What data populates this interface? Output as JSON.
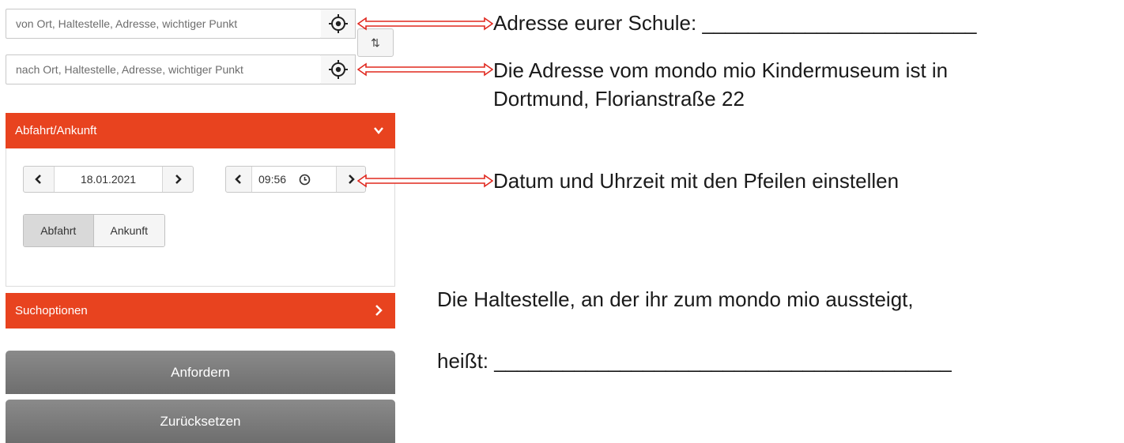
{
  "form": {
    "from_placeholder": "von Ort, Haltestelle, Adresse, wichtiger Punkt",
    "to_placeholder": "nach Ort, Haltestelle, Adresse, wichtiger Punkt",
    "swap_glyph": "⇅",
    "gps_icon": "crosshair-icon"
  },
  "departure_panel": {
    "title": "Abfahrt/Ankunft",
    "date": "18.01.2021",
    "time": "09:56",
    "mode_options": [
      "Abfahrt",
      "Ankunft"
    ],
    "mode_selected": "Abfahrt"
  },
  "search_options": {
    "title": "Suchoptionen"
  },
  "buttons": {
    "request": "Anfordern",
    "reset": "Zurücksetzen"
  },
  "annotations": {
    "school_address": "Adresse eurer Schule: ________________________",
    "museum_line1": "Die Adresse vom mondo mio Kindermuseum ist in",
    "museum_line2": "Dortmund, Florianstraße 22",
    "datetime_hint": "Datum und Uhrzeit mit den Pfeilen einstellen",
    "stop_line1": "Die Haltestelle, an der ihr zum mondo mio aussteigt,",
    "stop_line2": "heißt: ________________________________________"
  },
  "colors": {
    "accent": "#e8431f",
    "arrow": "#e0281f",
    "button_gray": "#787878"
  }
}
